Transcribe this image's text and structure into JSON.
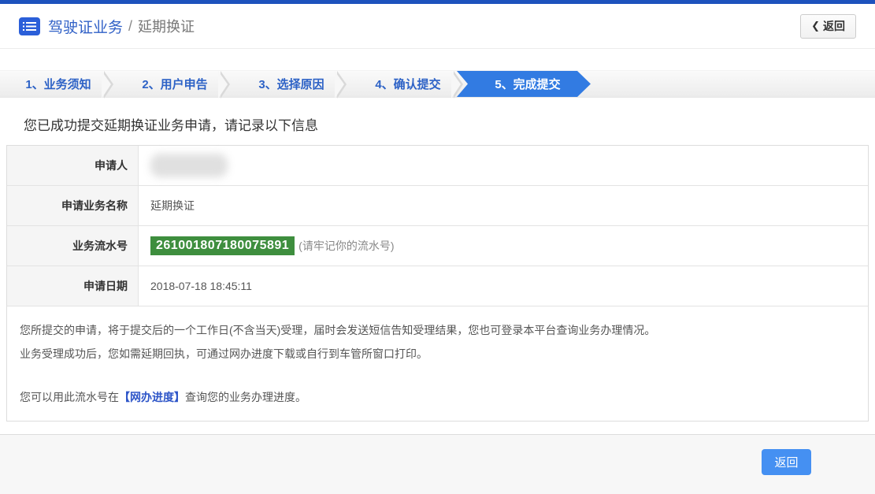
{
  "header": {
    "title": "驾驶证业务",
    "separator": "/",
    "subtitle": "延期换证",
    "back_chevron": "❮",
    "back_label": "返回"
  },
  "steps": [
    {
      "label": "1、业务须知",
      "active": false
    },
    {
      "label": "2、用户申告",
      "active": false
    },
    {
      "label": "3、选择原因",
      "active": false
    },
    {
      "label": "4、确认提交",
      "active": false
    },
    {
      "label": "5、完成提交",
      "active": true
    }
  ],
  "main": {
    "success_message": "您已成功提交延期换证业务申请，请记录以下信息",
    "table": {
      "rows": [
        {
          "label": "申请人",
          "value": "",
          "redacted": true
        },
        {
          "label": "申请业务名称",
          "value": "延期换证"
        },
        {
          "label": "业务流水号",
          "value": "261001807180075891",
          "hint": "(请牢记你的流水号)"
        },
        {
          "label": "申请日期",
          "value": "2018-07-18 18:45:11"
        }
      ]
    },
    "notes": [
      "您所提交的申请，将于提交后的一个工作日(不含当天)受理，届时会发送短信告知受理结果，您也可登录本平台查询业务办理情况。",
      "业务受理成功后，您如需延期回执，可通过网办进度下载或自行到车管所窗口打印。"
    ],
    "progress_line": {
      "prefix": "您可以用此流水号在",
      "link": "【网办进度】",
      "suffix": "查询您的业务办理进度。"
    }
  },
  "footer": {
    "back_label": "返回"
  },
  "colors": {
    "topbar": "#1d52bd",
    "accent_blue": "#327be2",
    "tab_text_blue": "#2d62c6",
    "serial_green": "#3e8e3e",
    "link_blue": "#2d55c8",
    "button_blue": "#4590f2"
  }
}
